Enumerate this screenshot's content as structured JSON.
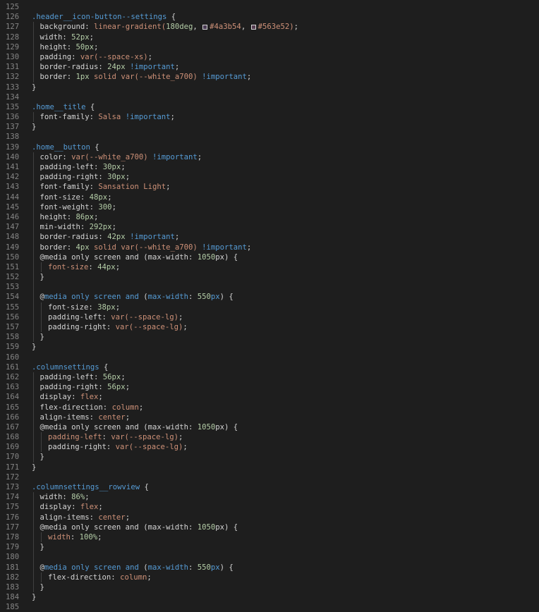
{
  "colors": {
    "background": "#1e1e1e",
    "gutter": "#858585",
    "selector": "#569cd6",
    "property": "#d4d4d4",
    "number": "#b5cea8",
    "value": "#ce9178",
    "keyword": "#569cd6"
  },
  "lines": [
    {
      "n": "125",
      "indent": 0,
      "segs": []
    },
    {
      "n": "126",
      "indent": 0,
      "segs": [
        [
          "sel",
          ".header__icon-button--settings"
        ],
        [
          "punc",
          " {"
        ]
      ]
    },
    {
      "n": "127",
      "indent": 1,
      "segs": [
        [
          "prop",
          "background: "
        ],
        [
          "fn",
          "linear-gradient("
        ],
        [
          "num",
          "180deg"
        ],
        [
          "punc",
          ", "
        ],
        [
          "swatch",
          "#4a3b54"
        ],
        [
          "val",
          "#4a3b54"
        ],
        [
          "punc",
          ", "
        ],
        [
          "swatch",
          "#563e52"
        ],
        [
          "val",
          "#563e52"
        ],
        [
          "fn",
          ")"
        ],
        [
          "punc",
          ";"
        ]
      ]
    },
    {
      "n": "128",
      "indent": 1,
      "segs": [
        [
          "prop",
          "width: "
        ],
        [
          "num",
          "52px"
        ],
        [
          "punc",
          ";"
        ]
      ]
    },
    {
      "n": "129",
      "indent": 1,
      "segs": [
        [
          "prop",
          "height: "
        ],
        [
          "num",
          "50px"
        ],
        [
          "punc",
          ";"
        ]
      ]
    },
    {
      "n": "130",
      "indent": 1,
      "segs": [
        [
          "prop",
          "padding: "
        ],
        [
          "val",
          "var(--space-xs)"
        ],
        [
          "punc",
          ";"
        ]
      ]
    },
    {
      "n": "131",
      "indent": 1,
      "segs": [
        [
          "prop",
          "border-radius: "
        ],
        [
          "num",
          "24px"
        ],
        [
          "kw",
          " !important"
        ],
        [
          "punc",
          ";"
        ]
      ]
    },
    {
      "n": "132",
      "indent": 1,
      "segs": [
        [
          "prop",
          "border: "
        ],
        [
          "num",
          "1px"
        ],
        [
          "val",
          " solid var(--white_a700)"
        ],
        [
          "kw",
          " !important"
        ],
        [
          "punc",
          ";"
        ]
      ]
    },
    {
      "n": "133",
      "indent": 0,
      "segs": [
        [
          "punc",
          "}"
        ]
      ]
    },
    {
      "n": "134",
      "indent": 0,
      "segs": []
    },
    {
      "n": "135",
      "indent": 0,
      "segs": [
        [
          "sel",
          ".home__title"
        ],
        [
          "punc",
          " {"
        ]
      ]
    },
    {
      "n": "136",
      "indent": 1,
      "segs": [
        [
          "prop",
          "font-family: "
        ],
        [
          "val",
          "Salsa"
        ],
        [
          "kw",
          " !important"
        ],
        [
          "punc",
          ";"
        ]
      ]
    },
    {
      "n": "137",
      "indent": 0,
      "segs": [
        [
          "punc",
          "}"
        ]
      ]
    },
    {
      "n": "138",
      "indent": 0,
      "segs": []
    },
    {
      "n": "139",
      "indent": 0,
      "segs": [
        [
          "sel",
          ".home__button"
        ],
        [
          "punc",
          " {"
        ]
      ]
    },
    {
      "n": "140",
      "indent": 1,
      "segs": [
        [
          "prop",
          "color: "
        ],
        [
          "val",
          "var(--white_a700)"
        ],
        [
          "kw",
          " !important"
        ],
        [
          "punc",
          ";"
        ]
      ]
    },
    {
      "n": "141",
      "indent": 1,
      "segs": [
        [
          "prop",
          "padding-left: "
        ],
        [
          "num",
          "30px"
        ],
        [
          "punc",
          ";"
        ]
      ]
    },
    {
      "n": "142",
      "indent": 1,
      "segs": [
        [
          "prop",
          "padding-right: "
        ],
        [
          "num",
          "30px"
        ],
        [
          "punc",
          ";"
        ]
      ]
    },
    {
      "n": "143",
      "indent": 1,
      "segs": [
        [
          "prop",
          "font-family: "
        ],
        [
          "val",
          "Sansation Light"
        ],
        [
          "punc",
          ";"
        ]
      ]
    },
    {
      "n": "144",
      "indent": 1,
      "segs": [
        [
          "prop",
          "font-size: "
        ],
        [
          "num",
          "48px"
        ],
        [
          "punc",
          ";"
        ]
      ]
    },
    {
      "n": "145",
      "indent": 1,
      "segs": [
        [
          "prop",
          "font-weight: "
        ],
        [
          "num",
          "300"
        ],
        [
          "punc",
          ";"
        ]
      ]
    },
    {
      "n": "146",
      "indent": 1,
      "segs": [
        [
          "prop",
          "height: "
        ],
        [
          "num",
          "86px"
        ],
        [
          "punc",
          ";"
        ]
      ]
    },
    {
      "n": "147",
      "indent": 1,
      "segs": [
        [
          "prop",
          "min-width: "
        ],
        [
          "num",
          "292px"
        ],
        [
          "punc",
          ";"
        ]
      ]
    },
    {
      "n": "148",
      "indent": 1,
      "segs": [
        [
          "prop",
          "border-radius: "
        ],
        [
          "num",
          "42px"
        ],
        [
          "kw",
          " !important"
        ],
        [
          "punc",
          ";"
        ]
      ]
    },
    {
      "n": "149",
      "indent": 1,
      "segs": [
        [
          "prop",
          "border: "
        ],
        [
          "num",
          "4px"
        ],
        [
          "val",
          " solid var(--white_a700)"
        ],
        [
          "kw",
          " !important"
        ],
        [
          "punc",
          ";"
        ]
      ]
    },
    {
      "n": "150",
      "indent": 1,
      "segs": [
        [
          "prop",
          "@media only screen and (max-width: "
        ],
        [
          "num",
          "1050"
        ],
        [
          "prop",
          "px) {"
        ]
      ]
    },
    {
      "n": "151",
      "indent": 2,
      "segs": [
        [
          "val",
          "font-size"
        ],
        [
          "prop",
          ": "
        ],
        [
          "num",
          "44px"
        ],
        [
          "punc",
          ";"
        ]
      ]
    },
    {
      "n": "152",
      "indent": 1,
      "segs": [
        [
          "punc",
          "}"
        ]
      ]
    },
    {
      "n": "153",
      "indent": 1,
      "segs": []
    },
    {
      "n": "154",
      "indent": 1,
      "segs": [
        [
          "prop",
          "@"
        ],
        [
          "kw",
          "media only screen and"
        ],
        [
          "prop",
          " ("
        ],
        [
          "kw",
          "max-width"
        ],
        [
          "prop",
          ": "
        ],
        [
          "num",
          "550"
        ],
        [
          "kw",
          "px"
        ],
        [
          "prop",
          ") {"
        ]
      ]
    },
    {
      "n": "155",
      "indent": 2,
      "segs": [
        [
          "prop",
          "font-size: "
        ],
        [
          "num",
          "38px"
        ],
        [
          "punc",
          ";"
        ]
      ]
    },
    {
      "n": "156",
      "indent": 2,
      "segs": [
        [
          "prop",
          "padding-left: "
        ],
        [
          "val",
          "var(--space-lg)"
        ],
        [
          "punc",
          ";"
        ]
      ]
    },
    {
      "n": "157",
      "indent": 2,
      "segs": [
        [
          "prop",
          "padding-right: "
        ],
        [
          "val",
          "var(--space-lg)"
        ],
        [
          "punc",
          ";"
        ]
      ]
    },
    {
      "n": "158",
      "indent": 1,
      "segs": [
        [
          "punc",
          "}"
        ]
      ]
    },
    {
      "n": "159",
      "indent": 0,
      "segs": [
        [
          "punc",
          "}"
        ]
      ]
    },
    {
      "n": "160",
      "indent": 0,
      "segs": []
    },
    {
      "n": "161",
      "indent": 0,
      "segs": [
        [
          "sel",
          ".columnsettings"
        ],
        [
          "punc",
          " {"
        ]
      ]
    },
    {
      "n": "162",
      "indent": 1,
      "segs": [
        [
          "prop",
          "padding-left: "
        ],
        [
          "num",
          "56px"
        ],
        [
          "punc",
          ";"
        ]
      ]
    },
    {
      "n": "163",
      "indent": 1,
      "segs": [
        [
          "prop",
          "padding-right: "
        ],
        [
          "num",
          "56px"
        ],
        [
          "punc",
          ";"
        ]
      ]
    },
    {
      "n": "164",
      "indent": 1,
      "segs": [
        [
          "prop",
          "display: "
        ],
        [
          "val",
          "flex"
        ],
        [
          "punc",
          ";"
        ]
      ]
    },
    {
      "n": "165",
      "indent": 1,
      "segs": [
        [
          "prop",
          "flex-direction: "
        ],
        [
          "val",
          "column"
        ],
        [
          "punc",
          ";"
        ]
      ]
    },
    {
      "n": "166",
      "indent": 1,
      "segs": [
        [
          "prop",
          "align-items: "
        ],
        [
          "val",
          "center"
        ],
        [
          "punc",
          ";"
        ]
      ]
    },
    {
      "n": "167",
      "indent": 1,
      "segs": [
        [
          "prop",
          "@media only screen and (max-width: "
        ],
        [
          "num",
          "1050"
        ],
        [
          "prop",
          "px) {"
        ]
      ]
    },
    {
      "n": "168",
      "indent": 2,
      "segs": [
        [
          "val",
          "padding-left"
        ],
        [
          "prop",
          ": "
        ],
        [
          "val",
          "var(--space-lg)"
        ],
        [
          "punc",
          ";"
        ]
      ]
    },
    {
      "n": "169",
      "indent": 2,
      "segs": [
        [
          "prop",
          "padding-right: "
        ],
        [
          "val",
          "var(--space-lg)"
        ],
        [
          "punc",
          ";"
        ]
      ]
    },
    {
      "n": "170",
      "indent": 1,
      "segs": [
        [
          "punc",
          "}"
        ]
      ]
    },
    {
      "n": "171",
      "indent": 0,
      "segs": [
        [
          "punc",
          "}"
        ]
      ]
    },
    {
      "n": "172",
      "indent": 0,
      "segs": []
    },
    {
      "n": "173",
      "indent": 0,
      "segs": [
        [
          "sel",
          ".columnsettings__rowview"
        ],
        [
          "punc",
          " {"
        ]
      ]
    },
    {
      "n": "174",
      "indent": 1,
      "segs": [
        [
          "prop",
          "width: "
        ],
        [
          "num",
          "86%"
        ],
        [
          "punc",
          ";"
        ]
      ]
    },
    {
      "n": "175",
      "indent": 1,
      "segs": [
        [
          "prop",
          "display: "
        ],
        [
          "val",
          "flex"
        ],
        [
          "punc",
          ";"
        ]
      ]
    },
    {
      "n": "176",
      "indent": 1,
      "segs": [
        [
          "prop",
          "align-items: "
        ],
        [
          "val",
          "center"
        ],
        [
          "punc",
          ";"
        ]
      ]
    },
    {
      "n": "177",
      "indent": 1,
      "segs": [
        [
          "prop",
          "@media only screen and (max-width: "
        ],
        [
          "num",
          "1050"
        ],
        [
          "prop",
          "px) {"
        ]
      ]
    },
    {
      "n": "178",
      "indent": 2,
      "segs": [
        [
          "val",
          "width"
        ],
        [
          "prop",
          ": "
        ],
        [
          "num",
          "100%"
        ],
        [
          "punc",
          ";"
        ]
      ]
    },
    {
      "n": "179",
      "indent": 1,
      "segs": [
        [
          "punc",
          "}"
        ]
      ]
    },
    {
      "n": "180",
      "indent": 1,
      "segs": []
    },
    {
      "n": "181",
      "indent": 1,
      "segs": [
        [
          "prop",
          "@"
        ],
        [
          "kw",
          "media only screen and"
        ],
        [
          "prop",
          " ("
        ],
        [
          "kw",
          "max-width"
        ],
        [
          "prop",
          ": "
        ],
        [
          "num",
          "550"
        ],
        [
          "kw",
          "px"
        ],
        [
          "prop",
          ") {"
        ]
      ]
    },
    {
      "n": "182",
      "indent": 2,
      "segs": [
        [
          "prop",
          "flex-direction: "
        ],
        [
          "val",
          "column"
        ],
        [
          "punc",
          ";"
        ]
      ]
    },
    {
      "n": "183",
      "indent": 1,
      "segs": [
        [
          "punc",
          "}"
        ]
      ]
    },
    {
      "n": "184",
      "indent": 0,
      "segs": [
        [
          "punc",
          "}"
        ]
      ]
    },
    {
      "n": "185",
      "indent": 0,
      "segs": []
    }
  ]
}
